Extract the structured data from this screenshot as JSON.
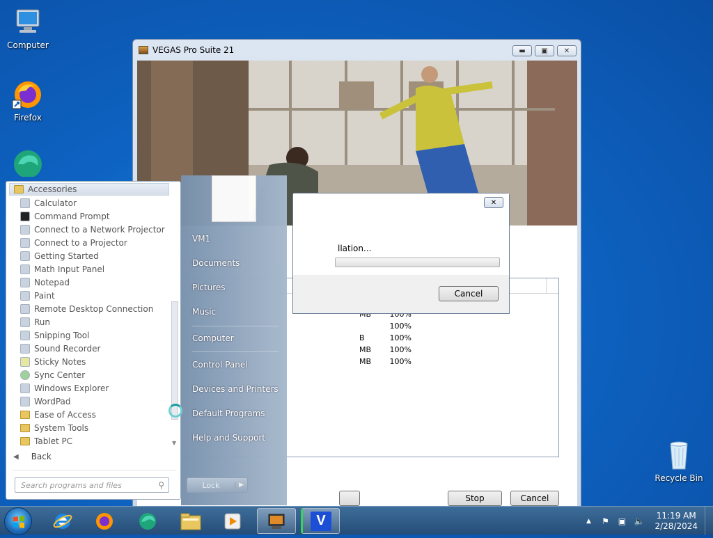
{
  "desktop": {
    "icons": [
      {
        "label": "Computer"
      },
      {
        "label": "Firefox"
      },
      {
        "label": ""
      },
      {
        "label": "Recycle Bin"
      }
    ]
  },
  "vegas_window": {
    "title": "VEGAS Pro Suite 21",
    "list_rows": [
      {
        "size": "MB",
        "pct": "100%"
      },
      {
        "size": "",
        "pct": "100%"
      },
      {
        "size": "B",
        "pct": "100%"
      },
      {
        "size": "MB",
        "pct": "100%"
      },
      {
        "size": "MB",
        "pct": "100%"
      }
    ],
    "stop_label": "Stop",
    "cancel_label": "Cancel"
  },
  "progress_dialog": {
    "message": "llation...",
    "cancel_label": "Cancel",
    "progress": 0
  },
  "start_menu": {
    "folder": "Accessories",
    "items": [
      {
        "label": "Calculator"
      },
      {
        "label": "Command Prompt"
      },
      {
        "label": "Connect to a Network Projector"
      },
      {
        "label": "Connect to a Projector"
      },
      {
        "label": "Getting Started"
      },
      {
        "label": "Math Input Panel"
      },
      {
        "label": "Notepad"
      },
      {
        "label": "Paint"
      },
      {
        "label": "Remote Desktop Connection"
      },
      {
        "label": "Run"
      },
      {
        "label": "Snipping Tool"
      },
      {
        "label": "Sound Recorder"
      },
      {
        "label": "Sticky Notes"
      },
      {
        "label": "Sync Center"
      },
      {
        "label": "Windows Explorer"
      },
      {
        "label": "WordPad"
      },
      {
        "label": "Ease of Access"
      },
      {
        "label": "System Tools"
      },
      {
        "label": "Tablet PC"
      }
    ],
    "back_label": "Back",
    "search_placeholder": "Search programs and files",
    "right_links": [
      {
        "label": "VM1"
      },
      {
        "label": "Documents"
      },
      {
        "label": "Pictures"
      },
      {
        "label": "Music"
      },
      {
        "label": "Computer"
      },
      {
        "label": "Control Panel"
      },
      {
        "label": "Devices and Printers"
      },
      {
        "label": "Default Programs"
      },
      {
        "label": "Help and Support"
      }
    ],
    "lock_label": "Lock"
  },
  "taskbar": {
    "time": "11:19 AM",
    "date": "2/28/2024"
  }
}
